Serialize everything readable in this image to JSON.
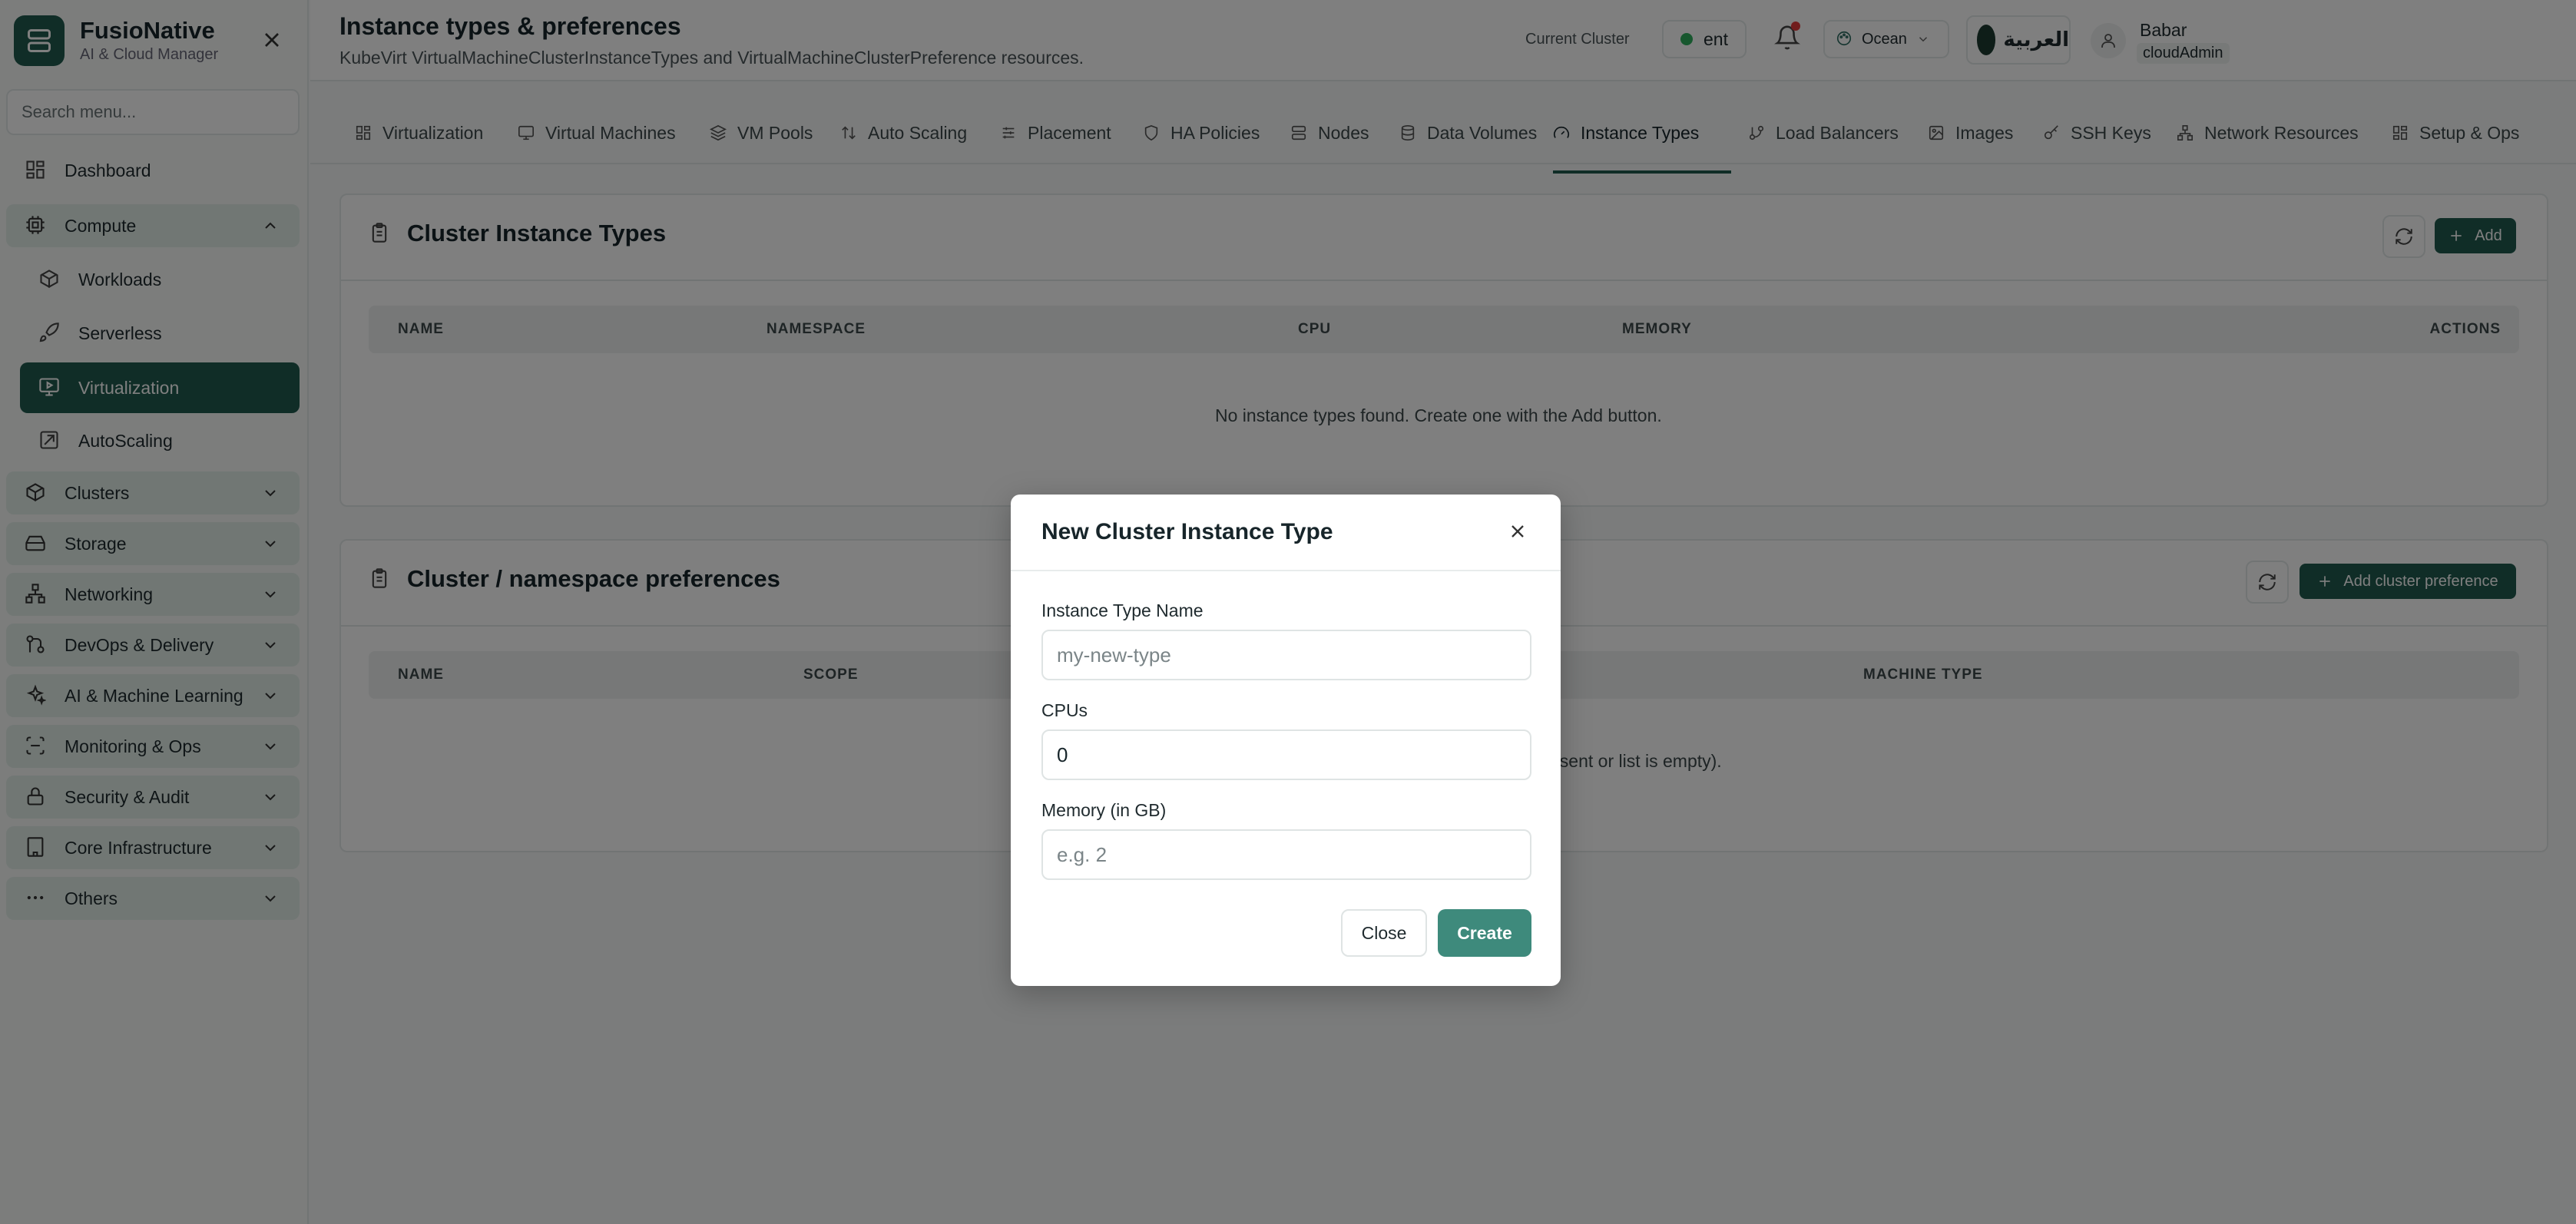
{
  "brand": {
    "title": "FusioNative",
    "subtitle": "AI & Cloud Manager"
  },
  "sidebar": {
    "search_placeholder": "Search menu...",
    "items": [
      {
        "label": "Dashboard",
        "icon": "dashboard-icon"
      },
      {
        "label": "Compute",
        "icon": "cpu-icon",
        "expanded": true
      },
      {
        "label": "Workloads",
        "icon": "box-icon"
      },
      {
        "label": "Serverless",
        "icon": "rocket-icon"
      },
      {
        "label": "Virtualization",
        "icon": "monitor-play-icon",
        "active": true
      },
      {
        "label": "AutoScaling",
        "icon": "scale-icon"
      },
      {
        "label": "Clusters",
        "icon": "cube-icon"
      },
      {
        "label": "Storage",
        "icon": "hard-drive-icon"
      },
      {
        "label": "Networking",
        "icon": "network-icon"
      },
      {
        "label": "DevOps & Delivery",
        "icon": "git-icon"
      },
      {
        "label": "AI & Machine Learning",
        "icon": "sparkles-icon"
      },
      {
        "label": "Monitoring & Ops",
        "icon": "scan-icon"
      },
      {
        "label": "Security & Audit",
        "icon": "lock-icon"
      },
      {
        "label": "Core Infrastructure",
        "icon": "building-icon"
      },
      {
        "label": "Others",
        "icon": "more-icon"
      }
    ]
  },
  "header": {
    "title": "Instance types & preferences",
    "subtitle": "KubeVirt VirtualMachineClusterInstanceTypes and VirtualMachineClusterPreference resources.",
    "cluster_label": "Current Cluster",
    "cluster_value": "ent",
    "theme": "Ocean",
    "language": "العربية",
    "user_name": "Babar",
    "user_role": "cloudAdmin"
  },
  "tabs": [
    {
      "label": "Virtualization"
    },
    {
      "label": "Virtual Machines"
    },
    {
      "label": "VM Pools"
    },
    {
      "label": "Auto Scaling"
    },
    {
      "label": "Placement"
    },
    {
      "label": "HA Policies"
    },
    {
      "label": "Nodes"
    },
    {
      "label": "Data Volumes"
    },
    {
      "label": "Instance Types",
      "active": true
    },
    {
      "label": "Load Balancers"
    },
    {
      "label": "Images"
    },
    {
      "label": "SSH Keys"
    },
    {
      "label": "Network Resources"
    },
    {
      "label": "Setup & Ops"
    }
  ],
  "instance_types_card": {
    "title": "Cluster Instance Types",
    "add_label": "Add",
    "columns": [
      "NAME",
      "NAMESPACE",
      "CPU",
      "MEMORY",
      "ACTIONS"
    ],
    "empty": "No instance types found. Create one with the Add button."
  },
  "preferences_card": {
    "title": "Cluster / namespace preferences",
    "add_label": "Add cluster preference",
    "columns": [
      "NAME",
      "SCOPE",
      "MACHINE TYPE"
    ],
    "empty_partial": "bsent or list is empty)."
  },
  "modal": {
    "title": "New Cluster Instance Type",
    "name_label": "Instance Type Name",
    "name_placeholder": "my-new-type",
    "cpu_label": "CPUs",
    "cpu_value": "0",
    "memory_label": "Memory (in GB)",
    "memory_placeholder": "e.g. 2",
    "close_label": "Close",
    "create_label": "Create"
  },
  "colors": {
    "primary": "#215b4f",
    "create_button": "#3e8a7c",
    "group_bg": "#e2efe9"
  }
}
